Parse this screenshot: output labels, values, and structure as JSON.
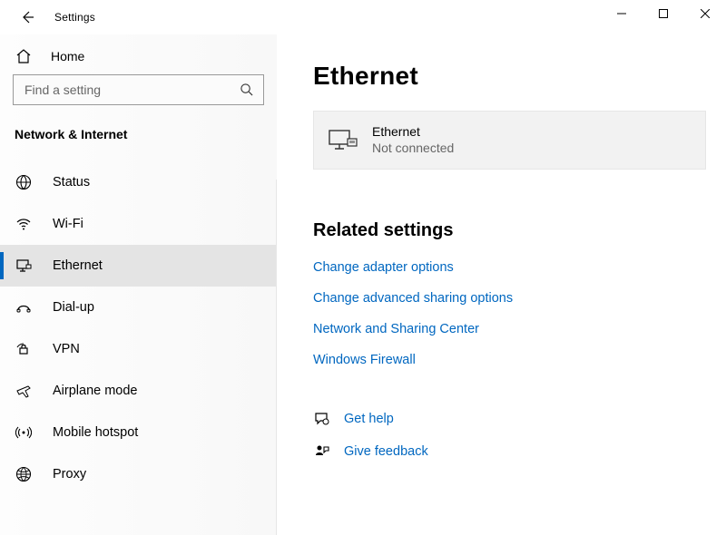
{
  "window": {
    "title": "Settings"
  },
  "sidebar": {
    "home_label": "Home",
    "search_placeholder": "Find a setting",
    "section_label": "Network & Internet",
    "items": [
      {
        "icon": "globe-icon",
        "label": "Status",
        "selected": false
      },
      {
        "icon": "wifi-icon",
        "label": "Wi-Fi",
        "selected": false
      },
      {
        "icon": "ethernet-icon",
        "label": "Ethernet",
        "selected": true
      },
      {
        "icon": "dialup-icon",
        "label": "Dial-up",
        "selected": false
      },
      {
        "icon": "vpn-icon",
        "label": "VPN",
        "selected": false
      },
      {
        "icon": "airplane-icon",
        "label": "Airplane mode",
        "selected": false
      },
      {
        "icon": "hotspot-icon",
        "label": "Mobile hotspot",
        "selected": false
      },
      {
        "icon": "proxy-icon",
        "label": "Proxy",
        "selected": false
      }
    ]
  },
  "main": {
    "heading": "Ethernet",
    "connection": {
      "name": "Ethernet",
      "status": "Not connected"
    },
    "related_heading": "Related settings",
    "related_links": [
      "Change adapter options",
      "Change advanced sharing options",
      "Network and Sharing Center",
      "Windows Firewall"
    ],
    "help_links": [
      {
        "icon": "chat-help-icon",
        "label": "Get help"
      },
      {
        "icon": "feedback-icon",
        "label": "Give feedback"
      }
    ]
  },
  "colors": {
    "accent": "#0067c0",
    "link": "#0067c0",
    "card_bg": "#f2f2f2"
  }
}
